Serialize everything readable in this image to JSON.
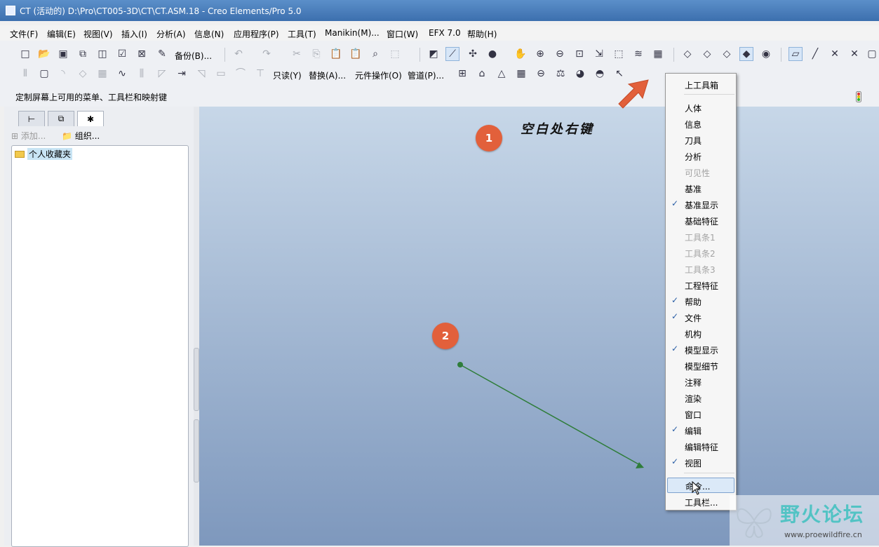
{
  "window": {
    "title": "CT (活动的) D:\\Pro\\CT005-3D\\CT\\CT.ASM.18 - Creo Elements/Pro 5.0"
  },
  "menubar": [
    "文件(F)",
    "编辑(E)",
    "视图(V)",
    "插入(I)",
    "分析(A)",
    "信息(N)",
    "应用程序(P)",
    "工具(T)",
    "Manikin(M)...",
    "窗口(W)",
    "EFX 7.0",
    "帮助(H)"
  ],
  "toolbar": {
    "backup_label": "备份(B)...",
    "readonly_label": "只读(Y)",
    "replace_label": "替换(A)...",
    "component_ops_label": "元件操作(O)",
    "piping_label": "管道(P)..."
  },
  "status": {
    "message": "定制屏幕上可用的菜单、工具栏和映射键"
  },
  "left_panel": {
    "add_label": "添加...",
    "organize_label": "组织...",
    "tree_node": "个人收藏夹"
  },
  "viewport": {
    "step1": "1",
    "step2": "2",
    "hint": "空白处右键"
  },
  "context_menu": {
    "items": [
      {
        "label": "上工具箱",
        "checked": false,
        "disabled": false
      },
      {
        "label": "人体",
        "checked": false,
        "disabled": false
      },
      {
        "label": "信息",
        "checked": false,
        "disabled": false
      },
      {
        "label": "刀具",
        "checked": false,
        "disabled": false
      },
      {
        "label": "分析",
        "checked": false,
        "disabled": false
      },
      {
        "label": "可见性",
        "checked": false,
        "disabled": true
      },
      {
        "label": "基准",
        "checked": false,
        "disabled": false
      },
      {
        "label": "基准显示",
        "checked": true,
        "disabled": false
      },
      {
        "label": "基础特征",
        "checked": false,
        "disabled": false
      },
      {
        "label": "工具条1",
        "checked": false,
        "disabled": true
      },
      {
        "label": "工具条2",
        "checked": false,
        "disabled": true
      },
      {
        "label": "工具条3",
        "checked": false,
        "disabled": true
      },
      {
        "label": "工程特征",
        "checked": false,
        "disabled": false
      },
      {
        "label": "帮助",
        "checked": true,
        "disabled": false
      },
      {
        "label": "文件",
        "checked": true,
        "disabled": false
      },
      {
        "label": "机构",
        "checked": false,
        "disabled": false
      },
      {
        "label": "模型显示",
        "checked": true,
        "disabled": false
      },
      {
        "label": "模型细节",
        "checked": false,
        "disabled": false
      },
      {
        "label": "注释",
        "checked": false,
        "disabled": false
      },
      {
        "label": "渲染",
        "checked": false,
        "disabled": false
      },
      {
        "label": "窗口",
        "checked": false,
        "disabled": false
      },
      {
        "label": "编辑",
        "checked": true,
        "disabled": false
      },
      {
        "label": "编辑特征",
        "checked": false,
        "disabled": false
      },
      {
        "label": "视图",
        "checked": true,
        "disabled": false
      },
      {
        "label": "命令...",
        "checked": false,
        "disabled": false,
        "hovered": true
      },
      {
        "label": "工具栏...",
        "checked": false,
        "disabled": false
      }
    ],
    "check_glyph": "✓"
  },
  "watermark": {
    "title": "野火论坛",
    "url": "www.proewildfire.cn"
  },
  "colors": {
    "badge": "#e2603b",
    "arrow": "#e2603b",
    "leader_line": "#2f7d3a",
    "title_bar": "#3c6fae",
    "watermark": "#52c3c4"
  }
}
